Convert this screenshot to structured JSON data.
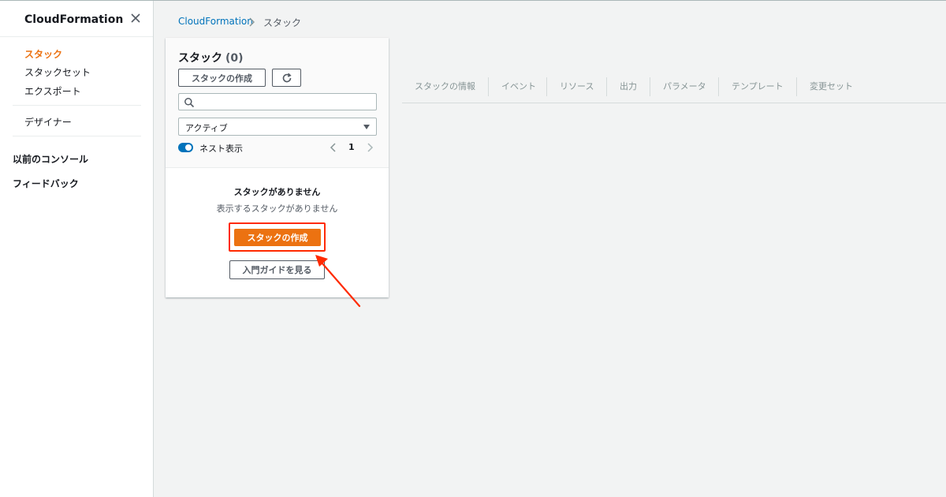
{
  "sidebar": {
    "title": "CloudFormation",
    "items": [
      {
        "label": "スタック",
        "active": true
      },
      {
        "label": "スタックセット"
      },
      {
        "label": "エクスポート"
      },
      {
        "label": "デザイナー"
      }
    ],
    "sections": [
      {
        "label": "以前のコンソール"
      },
      {
        "label": "フィードバック"
      }
    ]
  },
  "breadcrumb": {
    "root": "CloudFormation",
    "current": "スタック"
  },
  "stacks_panel": {
    "title": "スタック",
    "count": "(0)",
    "create_label": "スタックの作成",
    "search": {
      "value": "",
      "placeholder": ""
    },
    "filter": {
      "selected": "アクティブ"
    },
    "nested_label": "ネスト表示",
    "nested_on": true,
    "page": "1",
    "empty_title": "スタックがありません",
    "empty_subtitle": "表示するスタックがありません",
    "primary_create_label": "スタックの作成",
    "guide_label": "入門ガイドを見る"
  },
  "tabs": [
    "スタックの情報",
    "イベント",
    "リソース",
    "出力",
    "パラメータ",
    "テンプレート",
    "変更セット"
  ],
  "colors": {
    "accent": "#ec7211",
    "link": "#0073bb",
    "annotation": "#ff2a00",
    "background": "#f2f3f3"
  },
  "icons": [
    "close-icon",
    "refresh-icon",
    "search-icon",
    "caret-down-icon",
    "chevron-left-icon",
    "chevron-right-icon",
    "chevron-separator-icon"
  ]
}
